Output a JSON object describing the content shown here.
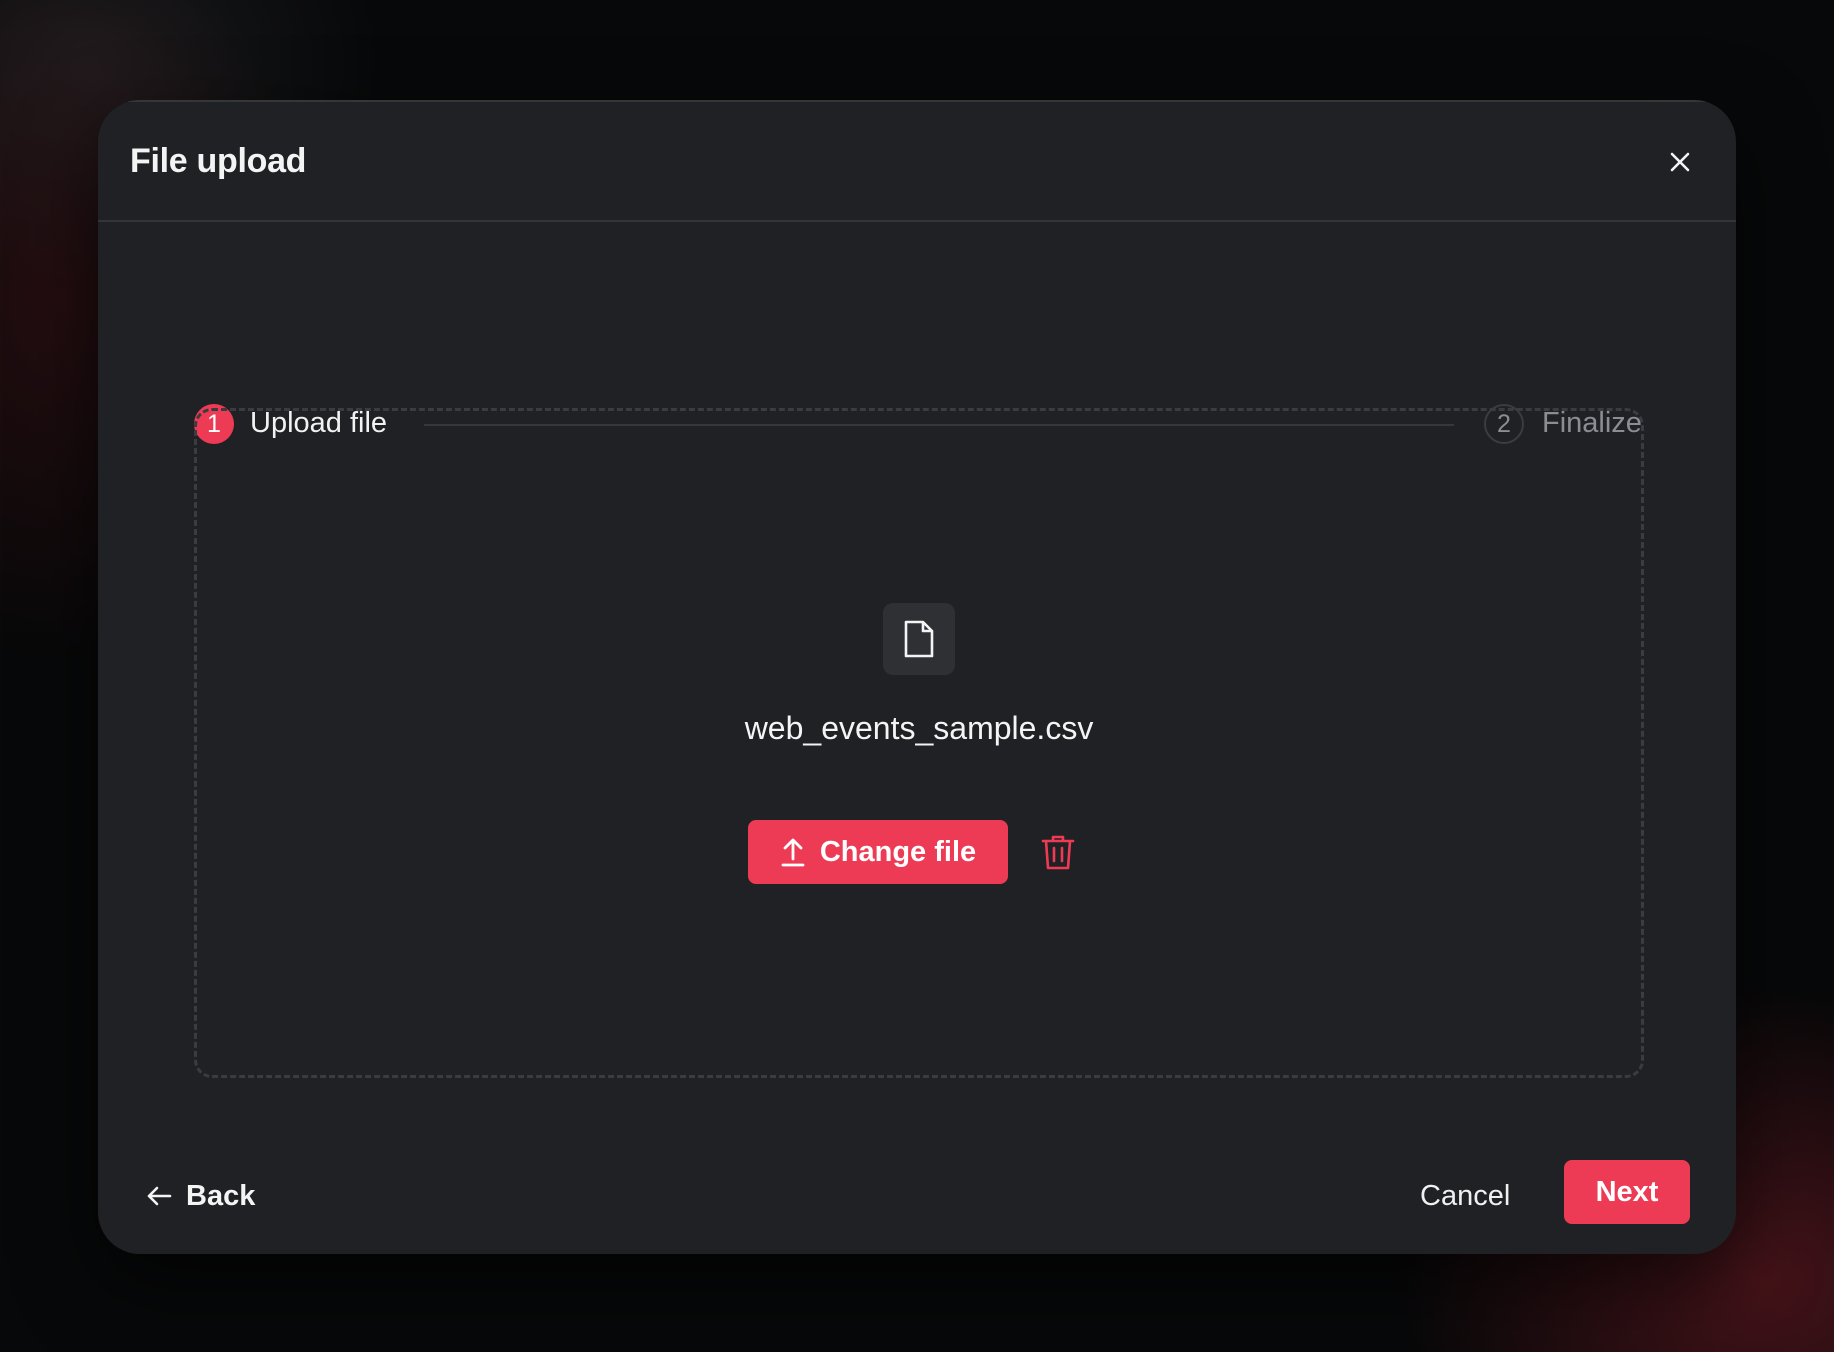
{
  "dialog": {
    "title": "File upload",
    "close_icon": "close-icon"
  },
  "stepper": {
    "steps": [
      {
        "number": "1",
        "label": "Upload file",
        "state": "active"
      },
      {
        "number": "2",
        "label": "Finalize",
        "state": "inactive"
      }
    ]
  },
  "dropzone": {
    "file_icon": "file-icon",
    "file_name": "web_events_sample.csv",
    "change_button_label": "Change file",
    "change_button_icon": "upload-icon",
    "delete_icon": "trash-icon"
  },
  "footer": {
    "back_label": "Back",
    "back_icon": "arrow-left-icon",
    "cancel_label": "Cancel",
    "next_label": "Next"
  },
  "colors": {
    "accent": "#ee3b55",
    "modal_background": "#202124",
    "page_background": "#070809"
  }
}
